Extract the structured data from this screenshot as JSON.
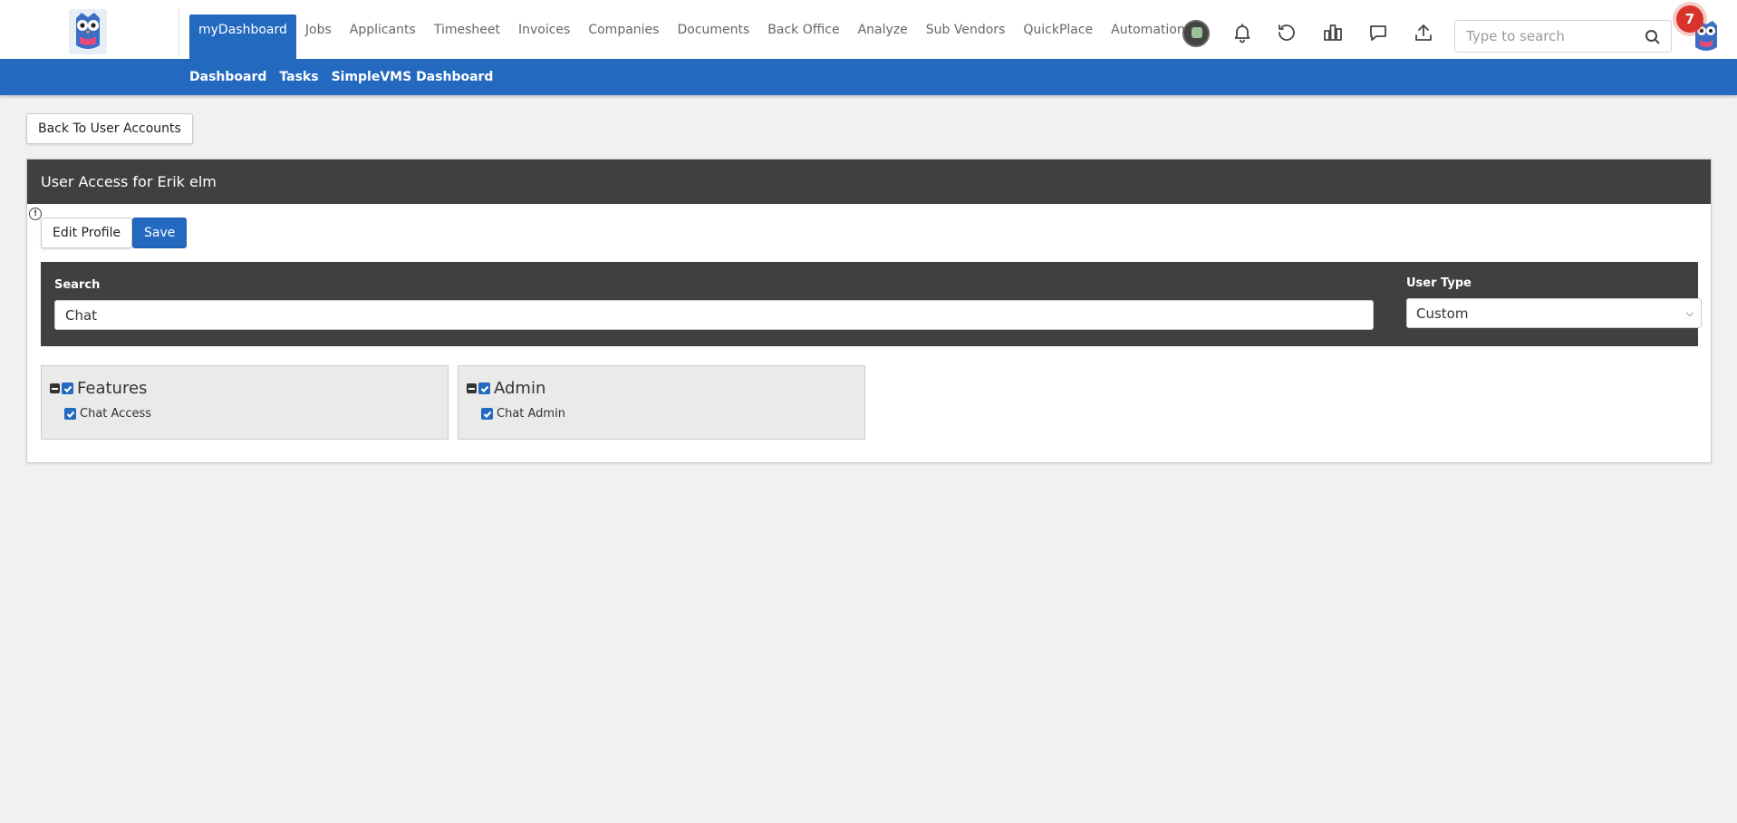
{
  "navbar": {
    "items": [
      {
        "label": "myDashboard",
        "active": true
      },
      {
        "label": "Jobs"
      },
      {
        "label": "Applicants"
      },
      {
        "label": "Timesheet"
      },
      {
        "label": "Invoices"
      },
      {
        "label": "Companies"
      },
      {
        "label": "Documents"
      },
      {
        "label": "Back Office"
      },
      {
        "label": "Analyze"
      },
      {
        "label": "Sub Vendors"
      },
      {
        "label": "QuickPlace"
      },
      {
        "label": "Automation"
      }
    ],
    "icons": [
      "language-globe-icon",
      "bell-icon",
      "history-icon",
      "chart-icon",
      "chat-icon",
      "upload-icon"
    ],
    "search_placeholder": "Type to search",
    "notification_count": "7"
  },
  "subnav": {
    "items": [
      "Dashboard",
      "Tasks",
      "SimpleVMS Dashboard"
    ]
  },
  "back_button": "Back To User Accounts",
  "panel": {
    "title": "User Access for Erik elm",
    "edit_profile_label": "Edit Profile",
    "save_label": "Save"
  },
  "filters": {
    "search_label": "Search",
    "search_value": "Chat",
    "user_type_label": "User Type",
    "user_type_value": "Custom"
  },
  "groups": [
    {
      "title": "Features",
      "checked": true,
      "items": [
        {
          "label": "Chat Access",
          "checked": true
        }
      ]
    },
    {
      "title": "Admin",
      "checked": true,
      "items": [
        {
          "label": "Chat Admin",
          "checked": true
        }
      ]
    }
  ],
  "colors": {
    "brand_blue": "#2269bf",
    "dark_header": "#404040",
    "badge_red": "#d9342b"
  }
}
